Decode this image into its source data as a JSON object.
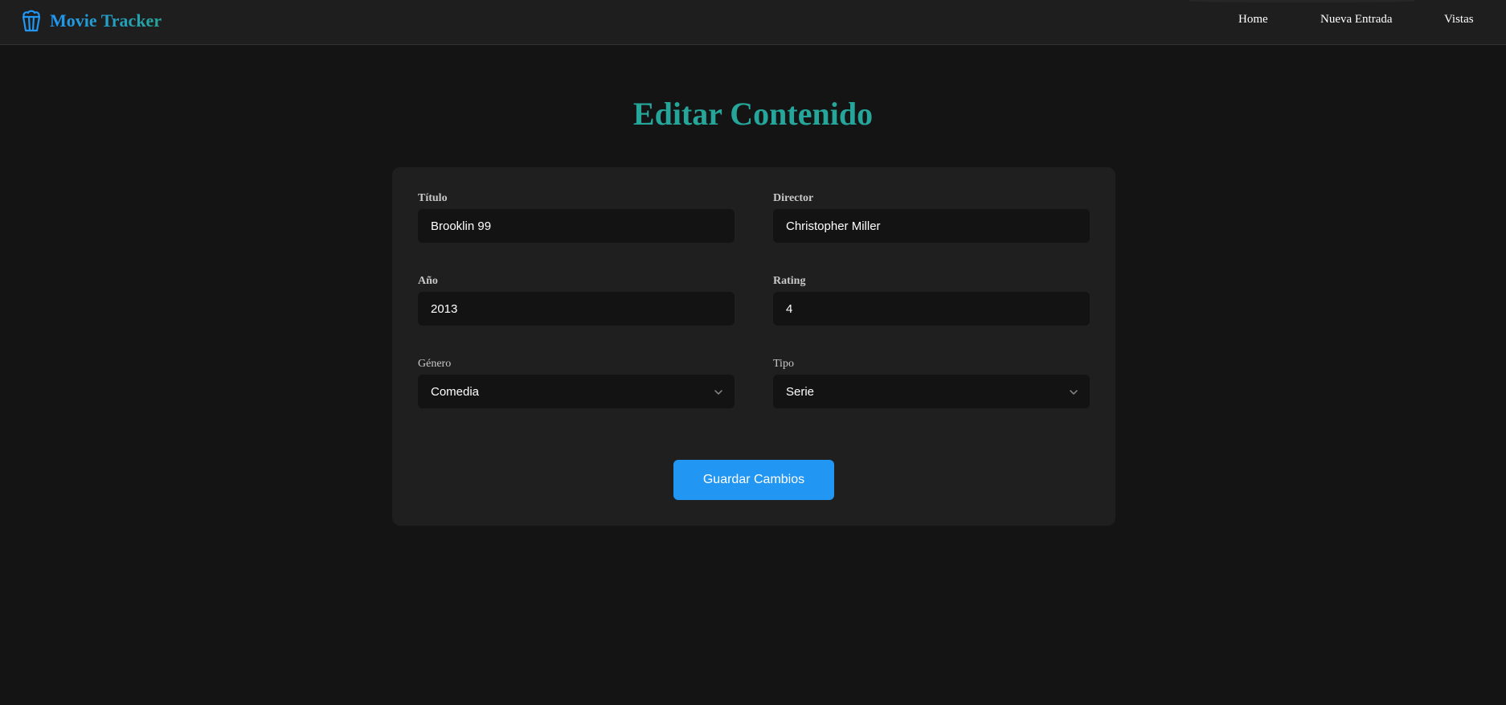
{
  "brand": {
    "title": "Movie Tracker",
    "icon": "popcorn-icon"
  },
  "nav": {
    "links": [
      {
        "label": "Home"
      },
      {
        "label": "Nueva Entrada"
      },
      {
        "label": "Vistas"
      }
    ]
  },
  "page": {
    "title": "Editar Contenido"
  },
  "form": {
    "titulo": {
      "label": "Título",
      "value": "Brooklin 99"
    },
    "director": {
      "label": "Director",
      "value": "Christopher Miller"
    },
    "anio": {
      "label": "Año",
      "value": "2013"
    },
    "rating": {
      "label": "Rating",
      "value": "4"
    },
    "genero": {
      "label": "Género",
      "selected": "Comedia"
    },
    "tipo": {
      "label": "Tipo",
      "selected": "Serie"
    },
    "submit_label": "Guardar Cambios"
  },
  "colors": {
    "background": "#141414",
    "card": "#1f1f1f",
    "input": "#131313",
    "accent_blue": "#2196f3",
    "accent_teal": "#26a69a"
  }
}
